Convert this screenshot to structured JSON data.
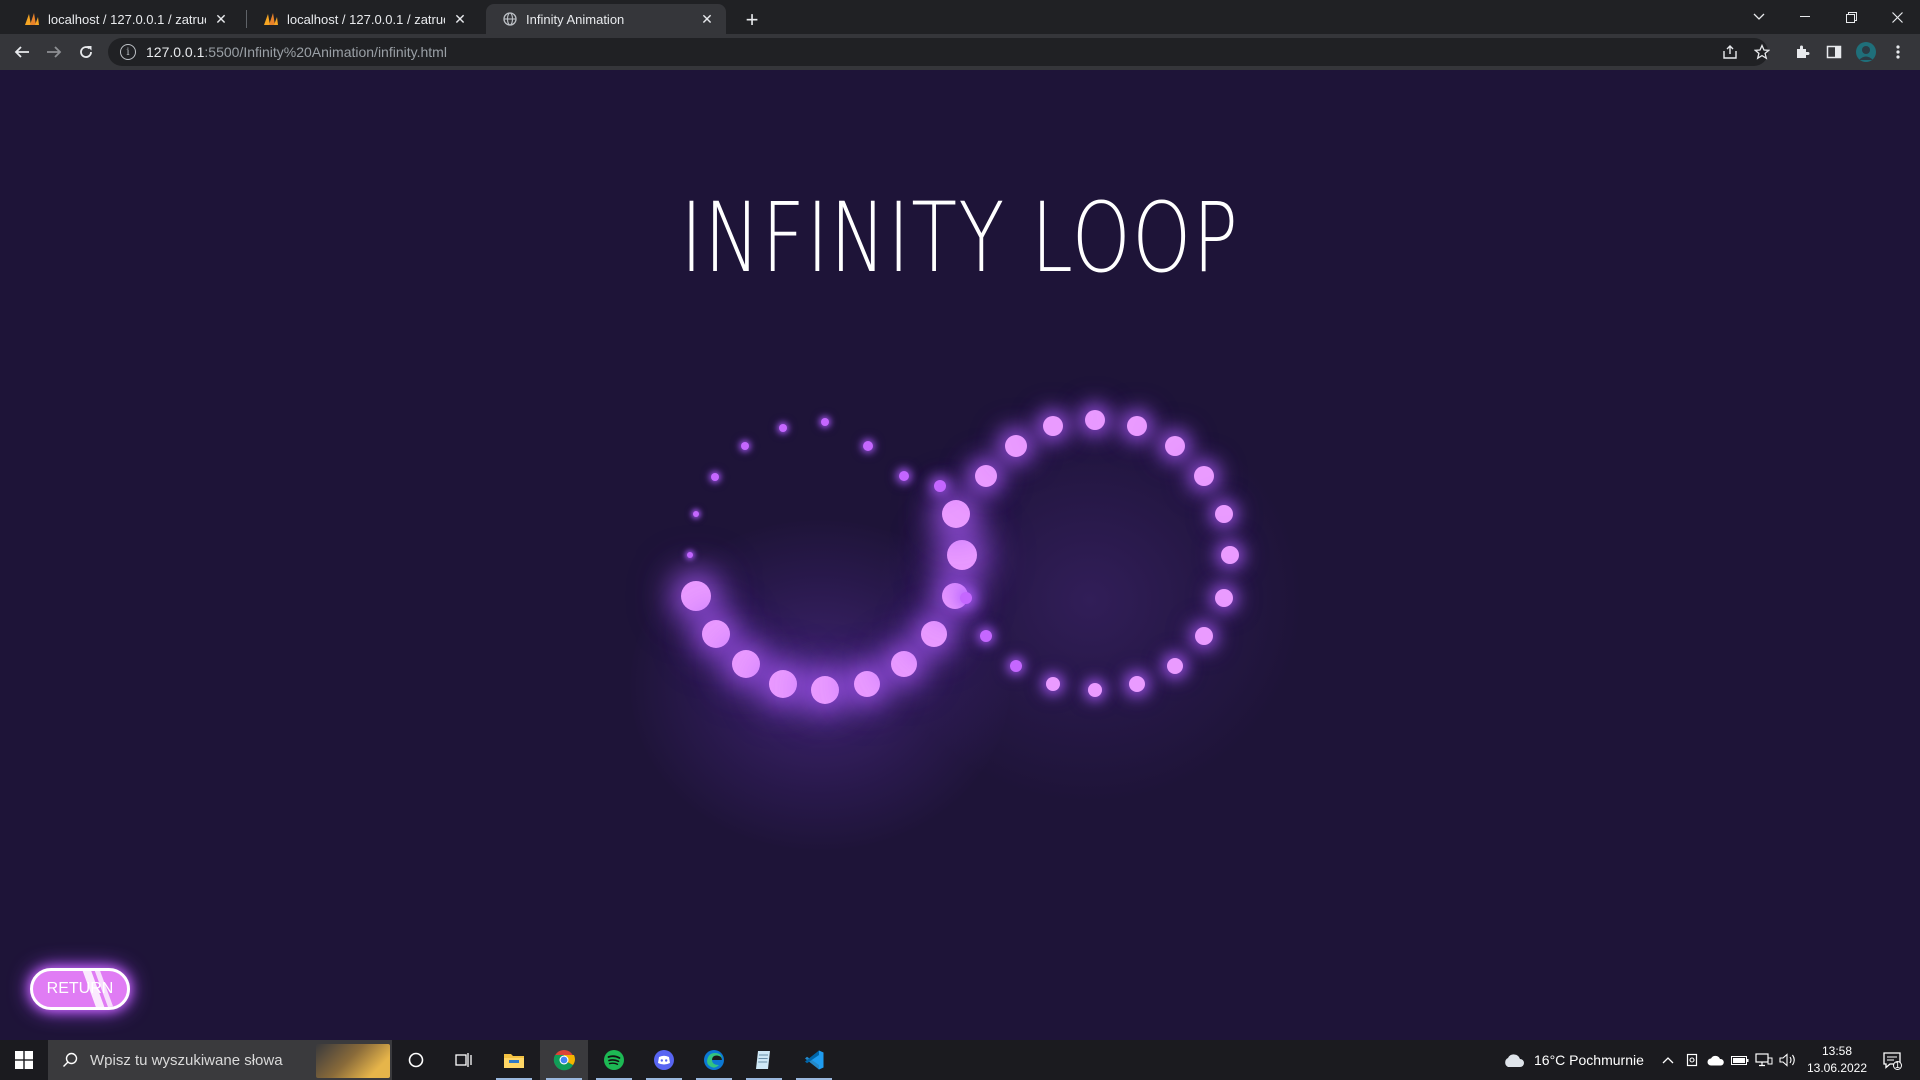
{
  "browser": {
    "tabs": [
      {
        "title": "localhost / 127.0.0.1 / zatrudnien",
        "active": false
      },
      {
        "title": "localhost / 127.0.0.1 / zatrudnien",
        "active": false
      },
      {
        "title": "Infinity Animation",
        "active": true
      }
    ],
    "new_tab_label": "+",
    "url_host": "127.0.0.1",
    "url_rest": ":5500/Infinity%20Animation/infinity.html"
  },
  "page": {
    "heading": "INFINITY LOOP",
    "return_label": "RETURN",
    "accent_color": "#e28cff",
    "background_color": "#1e1438"
  },
  "taskbar": {
    "search_placeholder": "Wpisz tu wyszukiwane słowa",
    "weather": "16°C  Pochmurnie",
    "time": "13:58",
    "date": "13.06.2022",
    "notification_count": "1",
    "apps": [
      "cortana-icon",
      "task-view-icon",
      "file-explorer-icon",
      "chrome-icon",
      "spotify-icon",
      "discord-icon",
      "edge-icon",
      "notepad-icon",
      "vscode-icon"
    ]
  }
}
